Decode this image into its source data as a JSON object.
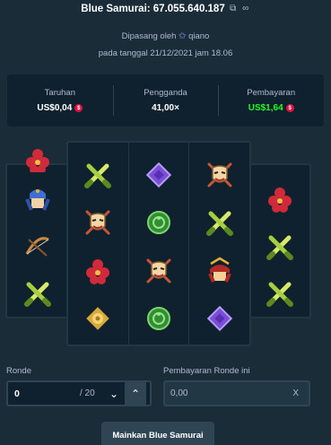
{
  "header": {
    "title": "Blue Samurai: 67.055.640.187",
    "copy_icon": "copy-icon",
    "link_icon": "link-icon"
  },
  "posted": {
    "prefix": "Dipasang oleh",
    "user": "qiano",
    "date": "pada tanggal 21/12/2021 jam 18.06"
  },
  "stats": {
    "bet": {
      "label": "Taruhan",
      "value": "US$0,04"
    },
    "multiplier": {
      "label": "Pengganda",
      "value": "41,00×"
    },
    "payout": {
      "label": "Pembayaran",
      "value": "US$1,64"
    }
  },
  "reels": {
    "symbols": [
      "crossed-swords",
      "purple-diamond",
      "samurai-mask",
      "shogun-helmet",
      "blue-samurai",
      "green-tomoe",
      "crossed-bows",
      "red-flower",
      "gold-emblem"
    ]
  },
  "controls": {
    "rounds_label": "Ronde",
    "rounds_value": "0",
    "rounds_total": "/ 20",
    "round_payout_label": "Pembayaran Ronde ini",
    "round_payout_value": "0,00",
    "clear_label": "X",
    "play_label": "Mainkan Blue Samurai"
  },
  "colors": {
    "background": "#1a2c38",
    "panel": "#0f212e",
    "border": "#2f4553",
    "muted_text": "#b1bad3",
    "win_green": "#1fff20",
    "coin_red": "#e0123d"
  }
}
